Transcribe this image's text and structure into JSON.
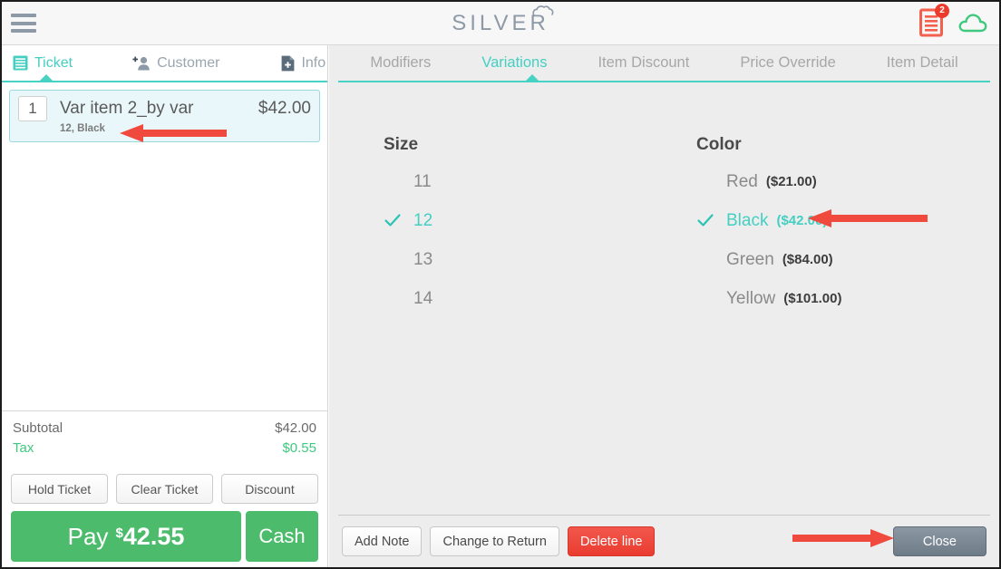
{
  "header": {
    "menu_icon": "hamburger-menu-icon",
    "logo_text": "SILVER",
    "logo_mark": "cloud-icon",
    "receipt_icon": "receipt-icon",
    "receipt_badge": "2",
    "cloud_icon": "cloud-sync-icon",
    "badge_color": "#ec3b2c",
    "receipt_color": "#f4604d",
    "cloud_color": "#3fc97e"
  },
  "sidebar": {
    "tabs": [
      {
        "label": "Ticket",
        "icon": "ticket-list-icon",
        "active": true
      },
      {
        "label": "Customer",
        "icon": "add-person-icon",
        "active": false
      },
      {
        "label": "Info",
        "icon": "document-plus-icon",
        "active": false
      }
    ],
    "ticket_items": [
      {
        "qty": "1",
        "name": "Var item 2_by var",
        "price": "$42.00",
        "variations": "12, Black"
      }
    ],
    "totals": [
      {
        "label": "Subtotal",
        "value": "$42.00"
      },
      {
        "label": "Tax",
        "value": "$0.55"
      }
    ],
    "actions": [
      {
        "label": "Hold Ticket"
      },
      {
        "label": "Clear Ticket"
      },
      {
        "label": "Discount"
      }
    ],
    "pay": {
      "word": "Pay",
      "currency": "$",
      "amount": "42.55",
      "cash_label": "Cash"
    }
  },
  "panel": {
    "tabs": [
      {
        "label": "Modifiers",
        "active": false
      },
      {
        "label": "Variations",
        "active": true
      },
      {
        "label": "Item Discount",
        "active": false
      },
      {
        "label": "Price Override",
        "active": false
      },
      {
        "label": "Item Detail",
        "active": false
      }
    ],
    "variation_groups": [
      {
        "title": "Size",
        "options": [
          {
            "label": "11",
            "price": "",
            "selected": false
          },
          {
            "label": "12",
            "price": "",
            "selected": true
          },
          {
            "label": "13",
            "price": "",
            "selected": false
          },
          {
            "label": "14",
            "price": "",
            "selected": false
          }
        ]
      },
      {
        "title": "Color",
        "options": [
          {
            "label": "Red",
            "price": "($21.00)",
            "selected": false
          },
          {
            "label": "Black",
            "price": "($42.00)",
            "selected": true
          },
          {
            "label": "Green",
            "price": "($84.00)",
            "selected": false
          },
          {
            "label": "Yellow",
            "price": "($101.00)",
            "selected": false
          }
        ]
      }
    ],
    "bottom_actions": [
      {
        "label": "Add Note",
        "style": "default"
      },
      {
        "label": "Change to Return",
        "style": "default"
      },
      {
        "label": "Delete line",
        "style": "danger"
      }
    ],
    "close_label": "Close"
  },
  "annotations": {
    "arrow_color": "#f04a3f",
    "arrows": [
      {
        "name": "arrow-to-ticket-variations",
        "direction": "left"
      },
      {
        "name": "arrow-to-black-variation",
        "direction": "left"
      },
      {
        "name": "arrow-to-close-button",
        "direction": "right"
      }
    ]
  },
  "theme": {
    "accent_teal": "#45cfc2",
    "green": "#4cbc6c",
    "red": "#ea3c30",
    "panel_bg": "#ededed",
    "slate": "#7a8792"
  }
}
